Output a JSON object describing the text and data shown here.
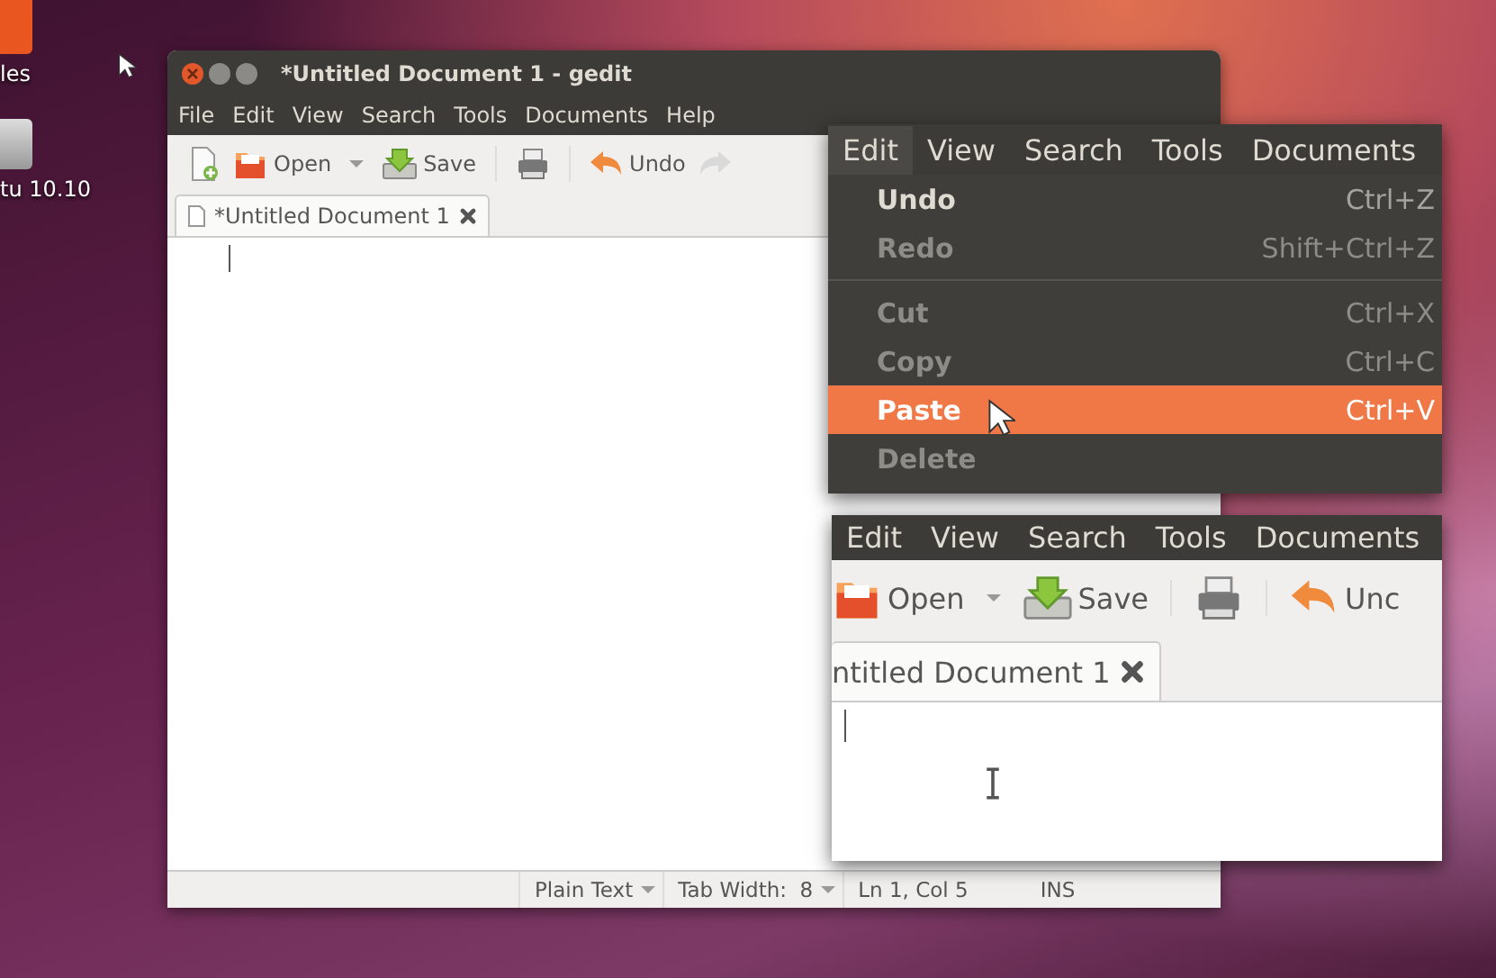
{
  "desktop": {
    "icons": [
      {
        "label": "les",
        "kind": "folder"
      },
      {
        "label": "tu 10.10",
        "kind": "drive"
      }
    ]
  },
  "window": {
    "title": "*Untitled Document 1 - gedit",
    "menu": [
      {
        "label": "File",
        "selected": false
      },
      {
        "label": "Edit",
        "selected": false
      },
      {
        "label": "View",
        "selected": false
      },
      {
        "label": "Search",
        "selected": false
      },
      {
        "label": "Tools",
        "selected": false
      },
      {
        "label": "Documents",
        "selected": false
      },
      {
        "label": "Help",
        "selected": false
      }
    ],
    "toolbar": [
      {
        "kind": "new"
      },
      {
        "kind": "open",
        "label": "Open",
        "dropdown": true
      },
      {
        "kind": "save",
        "label": "Save"
      },
      {
        "kind": "print"
      },
      {
        "kind": "undo",
        "label": "Undo"
      },
      {
        "kind": "redo",
        "disabled": true
      }
    ],
    "tabs": [
      {
        "label": "*Untitled Document 1",
        "selected": true
      }
    ],
    "status_bar": [
      {
        "kind": "dropdown",
        "text": "Plain Text"
      },
      {
        "kind": "dropdown",
        "text": "Tab Width:  8"
      },
      {
        "kind": "text",
        "text": "Ln 1, Col 5"
      },
      {
        "kind": "text",
        "text": "INS"
      }
    ]
  },
  "zoom_menu": {
    "menubar": [
      {
        "label": "Edit",
        "selected": true
      },
      {
        "label": "View",
        "selected": false
      },
      {
        "label": "Search",
        "selected": false
      },
      {
        "label": "Tools",
        "selected": false
      },
      {
        "label": "Documents",
        "selected": false
      }
    ],
    "items": [
      {
        "kind": "item",
        "label": "Undo",
        "shortcut": "Ctrl+Z",
        "disabled": false,
        "selected": false
      },
      {
        "kind": "item",
        "label": "Redo",
        "shortcut": "Shift+Ctrl+Z",
        "disabled": true,
        "selected": false
      },
      {
        "kind": "separator"
      },
      {
        "kind": "item",
        "label": "Cut",
        "shortcut": "Ctrl+X",
        "disabled": true,
        "selected": false
      },
      {
        "kind": "item",
        "label": "Copy",
        "shortcut": "Ctrl+C",
        "disabled": true,
        "selected": false
      },
      {
        "kind": "item",
        "label": "Paste",
        "shortcut": "Ctrl+V",
        "disabled": false,
        "selected": true
      },
      {
        "kind": "item",
        "label": "Delete",
        "disabled": true,
        "selected": false
      }
    ]
  },
  "zoom_editor": {
    "menubar": [
      {
        "label": "Edit",
        "selected": false
      },
      {
        "label": "View",
        "selected": false
      },
      {
        "label": "Search",
        "selected": false
      },
      {
        "label": "Tools",
        "selected": false
      },
      {
        "label": "Documents",
        "selected": false
      }
    ],
    "toolbar": [
      {
        "kind": "open",
        "label": "Open",
        "dropdown": true
      },
      {
        "kind": "save",
        "label": "Save"
      },
      {
        "kind": "print"
      },
      {
        "kind": "undo",
        "label": "Unc"
      }
    ],
    "tabs": [
      {
        "label": "ntitled Document 1",
        "selected": true
      }
    ]
  }
}
